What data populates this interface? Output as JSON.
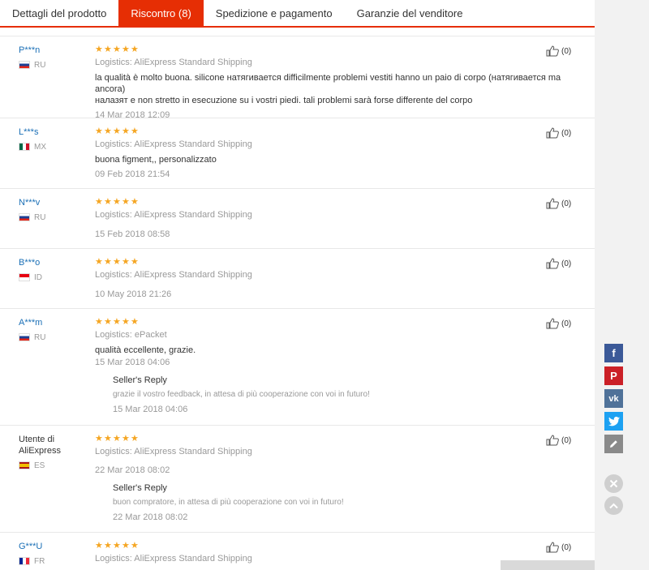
{
  "tabs": [
    {
      "label": "Dettagli del prodotto"
    },
    {
      "label": "Riscontro (8)"
    },
    {
      "label": "Spedizione e pagamento"
    },
    {
      "label": "Garanzie del venditore"
    }
  ],
  "reviews": [
    {
      "name": "P***n",
      "country": "RU",
      "flag": "flag-ru",
      "rating": 5,
      "logistics": "Logistics: AliExpress Standard Shipping",
      "text_line1": "la qualità è molto buona. silicone натягивается difficilmente problemi vestiti hanno un paio di corpo (натягивается ma ancora)",
      "text_line2": "налазят e non stretto in esecuzione su i vostri piedi. tali problemi sarà forse differente del corpo",
      "date": "14 Mar 2018 12:09",
      "helpful": "(0)"
    },
    {
      "name": "L***s",
      "country": "MX",
      "flag": "flag-mx",
      "rating": 5,
      "logistics": "Logistics: AliExpress Standard Shipping",
      "text_line1": "buona figment,, personalizzato",
      "date": "09 Feb 2018 21:54",
      "helpful": "(0)"
    },
    {
      "name": "N***v",
      "country": "RU",
      "flag": "flag-ru",
      "rating": 5,
      "logistics": "Logistics: AliExpress Standard Shipping",
      "date": "15 Feb 2018 08:58",
      "helpful": "(0)"
    },
    {
      "name": "B***o",
      "country": "ID",
      "flag": "flag-id",
      "rating": 5,
      "logistics": "Logistics: AliExpress Standard Shipping",
      "date": "10 May 2018 21:26",
      "helpful": "(0)"
    },
    {
      "name": "A***m",
      "country": "RU",
      "flag": "flag-ru",
      "rating": 5,
      "logistics": "Logistics: ePacket",
      "text_line1": "qualità eccellente, grazie.",
      "date": "15 Mar 2018 04:06",
      "helpful": "(0)",
      "reply": {
        "title": "Seller's Reply",
        "text": "grazie il vostro feedback, in attesa di più cooperazione con voi in futuro!",
        "date": "15 Mar 2018 04:06"
      }
    },
    {
      "name_line1": "Utente di",
      "name_line2": "AliExpress",
      "country": "ES",
      "flag": "flag-es",
      "rating": 5,
      "logistics": "Logistics: AliExpress Standard Shipping",
      "date": "22 Mar 2018 08:02",
      "helpful": "(0)",
      "reply": {
        "title": "Seller's Reply",
        "text": "buon compratore, in attesa di più cooperazione con voi in futuro!",
        "date": "22 Mar 2018 08:02"
      }
    },
    {
      "name": "G***U",
      "country": "FR",
      "flag": "flag-fr",
      "rating": 5,
      "logistics": "Logistics: AliExpress Standard Shipping",
      "helpful": "(0)"
    }
  ],
  "share": {
    "facebook_icon": "facebook-icon",
    "pinterest_icon": "pinterest-icon",
    "vk_icon": "vk-icon",
    "twitter_icon": "twitter-icon",
    "edit_icon": "pencil-icon"
  },
  "colors": {
    "accent": "#e62e04",
    "star": "#f5a623",
    "link": "#1a6fb6"
  }
}
